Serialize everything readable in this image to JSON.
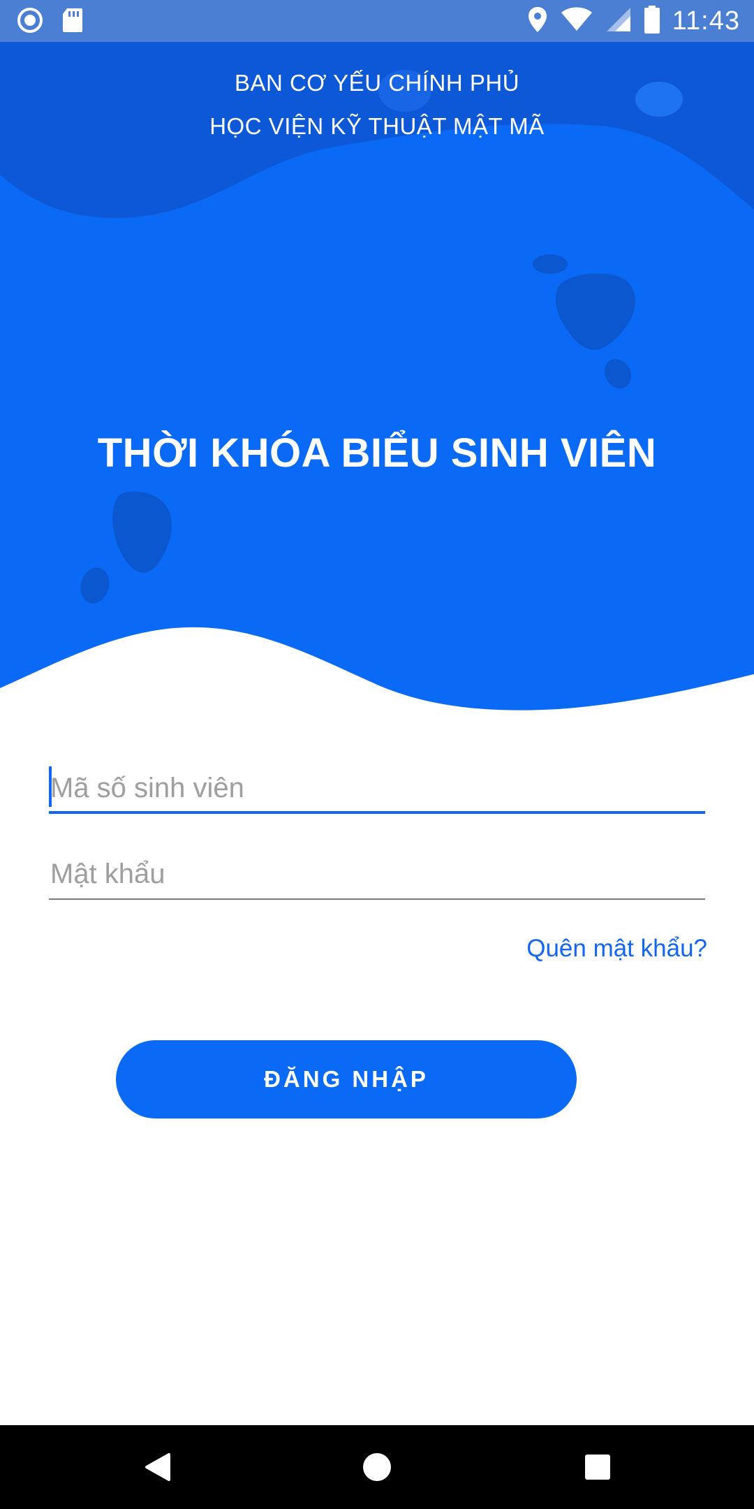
{
  "status_bar": {
    "time": "11:43",
    "left_icons": [
      "record-icon",
      "sd-card-icon"
    ],
    "right_icons": [
      "location-icon",
      "wifi-icon",
      "cellular-signal-icon",
      "battery-icon"
    ]
  },
  "header": {
    "org_line_1": "BAN CƠ YẾU CHÍNH PHỦ",
    "org_line_2": "HỌC VIỆN KỸ THUẬT MẬT MÃ",
    "app_title": "THỜI KHÓA BIỂU SINH VIÊN"
  },
  "form": {
    "student_id_placeholder": "Mã số sinh viên",
    "password_placeholder": "Mật khẩu",
    "forgot_password": "Quên mật khẩu?",
    "login_label": "ĐĂNG NHẬP"
  },
  "navigation": {
    "buttons": [
      "back",
      "home",
      "recent-apps"
    ]
  },
  "colors": {
    "primary": "#0a6af5",
    "primary_dark": "#0d58d6",
    "status_bar": "#4a7fd4",
    "blob": "#0b57cf",
    "placeholder": "#9e9e9e"
  }
}
